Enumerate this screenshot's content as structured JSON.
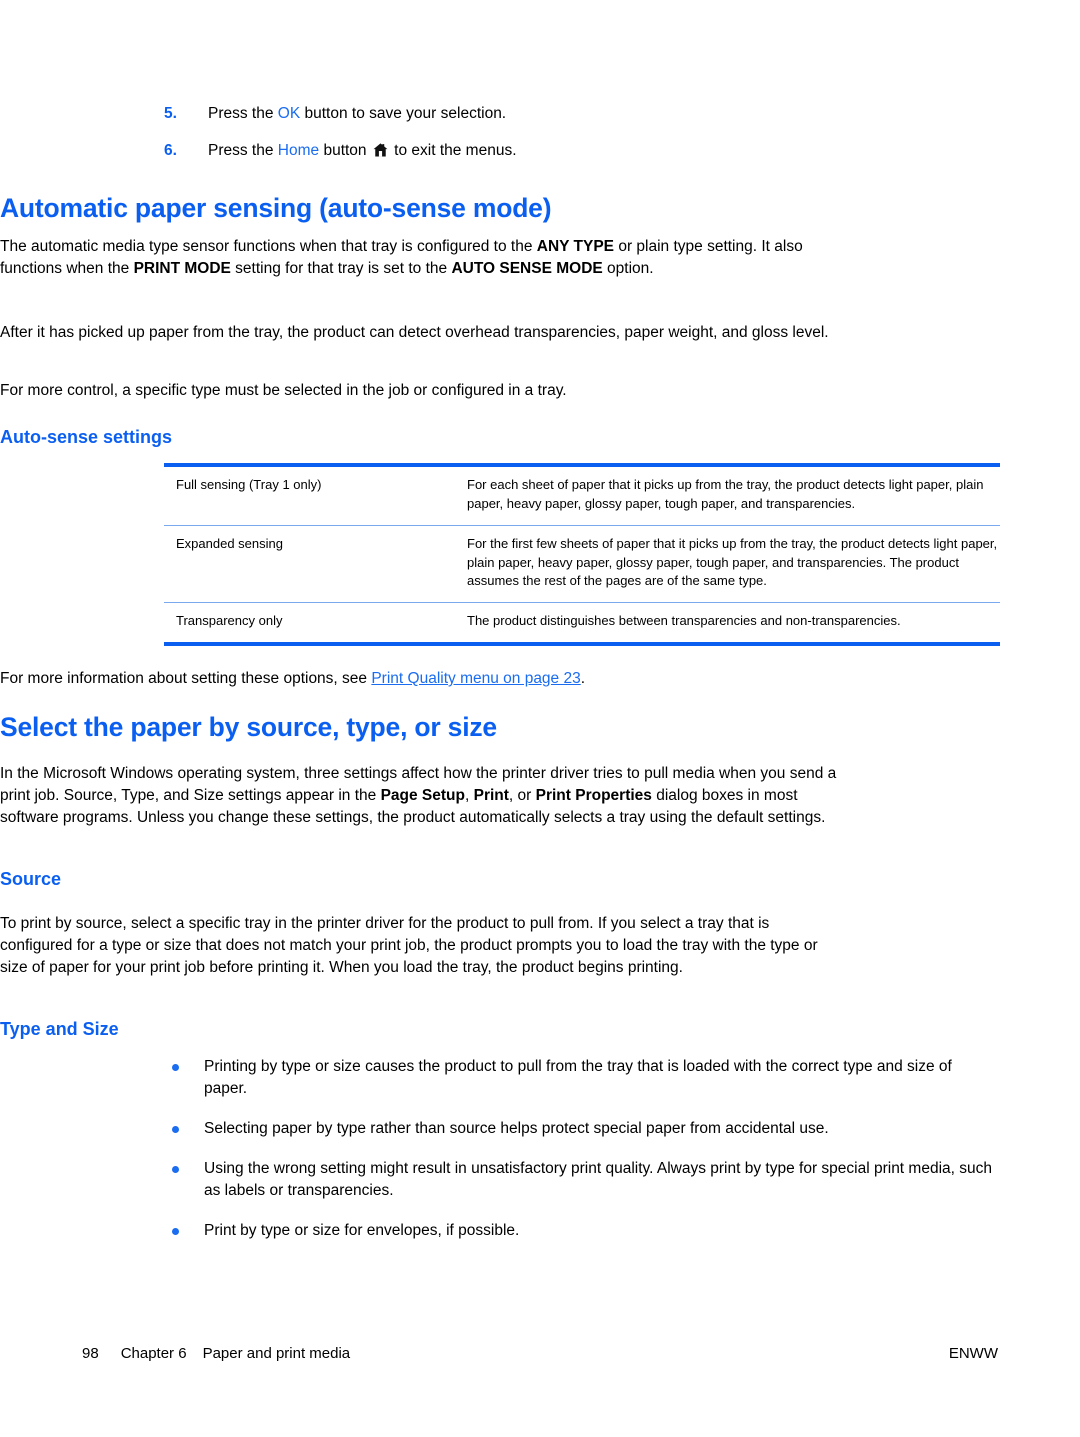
{
  "steps": [
    {
      "num": "5.",
      "pre": "Press the ",
      "key": "OK",
      "post": " button to save your selection.",
      "has_icon": false
    },
    {
      "num": "6.",
      "pre": "Press the ",
      "key": "Home",
      "mid": " button ",
      "icon": "home-icon",
      "post": " to exit the menus.",
      "has_icon": true
    }
  ],
  "section1": {
    "heading": "Automatic paper sensing (auto-sense mode)",
    "para1_a": "The automatic media type sensor functions when that tray is configured to the ",
    "para1_b": "ANY TYPE",
    "para1_c": " or plain type setting. It also functions when the ",
    "para1_d": "PRINT MODE",
    "para1_e": " setting for that tray is set to the ",
    "para1_f": "AUTO SENSE MODE",
    "para1_g": " option.",
    "para2": "After it has picked up paper from the tray, the product can detect overhead transparencies, paper weight, and gloss level.",
    "para3": "For more control, a specific type must be selected in the job or configured in a tray.",
    "subheading": "Auto-sense settings",
    "table": {
      "rows": [
        {
          "setting": "Full sensing (Tray 1 only)",
          "description": "For each sheet of paper that it picks up from the tray, the product detects light paper, plain paper, heavy paper, glossy paper, tough paper, and transparencies."
        },
        {
          "setting": "Expanded sensing",
          "description": "For the first few sheets of paper that it picks up from the tray, the product detects light paper, plain paper, heavy paper, glossy paper, tough paper, and transparencies. The product assumes the rest of the pages are of the same type."
        },
        {
          "setting": "Transparency only",
          "description": "The product distinguishes between transparencies and non-transparencies."
        }
      ]
    },
    "after_table_pre": "For more information about setting these options, see ",
    "after_table_link": "Print Quality menu on page 23",
    "after_table_post": "."
  },
  "section2": {
    "heading": "Select the paper by source, type, or size",
    "intro_a": "In the Microsoft Windows operating system, three settings affect how the printer driver tries to pull media when you send a print job. Source, Type, and Size settings appear in the ",
    "intro_b": "Page Setup",
    "intro_c": ", ",
    "intro_d": "Print",
    "intro_e": ", or ",
    "intro_f": "Print Properties",
    "intro_g": " dialog boxes in most software programs. Unless you change these settings, the product automatically selects a tray using the default settings.",
    "source": {
      "heading": "Source",
      "para": "To print by source, select a specific tray in the printer driver for the product to pull from. If you select a tray that is configured for a type or size that does not match your print job, the product prompts you to load the tray with the type or size of paper for your print job before printing it. When you load the tray, the product begins printing."
    },
    "type_size": {
      "heading": "Type and Size",
      "bullets": [
        "Printing by type or size causes the product to pull from the tray that is loaded with the correct type and size of paper.",
        "Selecting paper by type rather than source helps protect special paper from accidental use.",
        "Using the wrong setting might result in unsatisfactory print quality. Always print by type for special print media, such as labels or transparencies.",
        "Print by type or size for envelopes, if possible."
      ]
    }
  },
  "footer": {
    "page_number": "98",
    "chapter": "Chapter 6",
    "chapter_title": "Paper and print media",
    "locale": "ENWW"
  },
  "colors": {
    "heading_blue": "#0b5ff0",
    "link_blue": "#1a6cf0",
    "rule_blue": "#7aa9ef"
  }
}
